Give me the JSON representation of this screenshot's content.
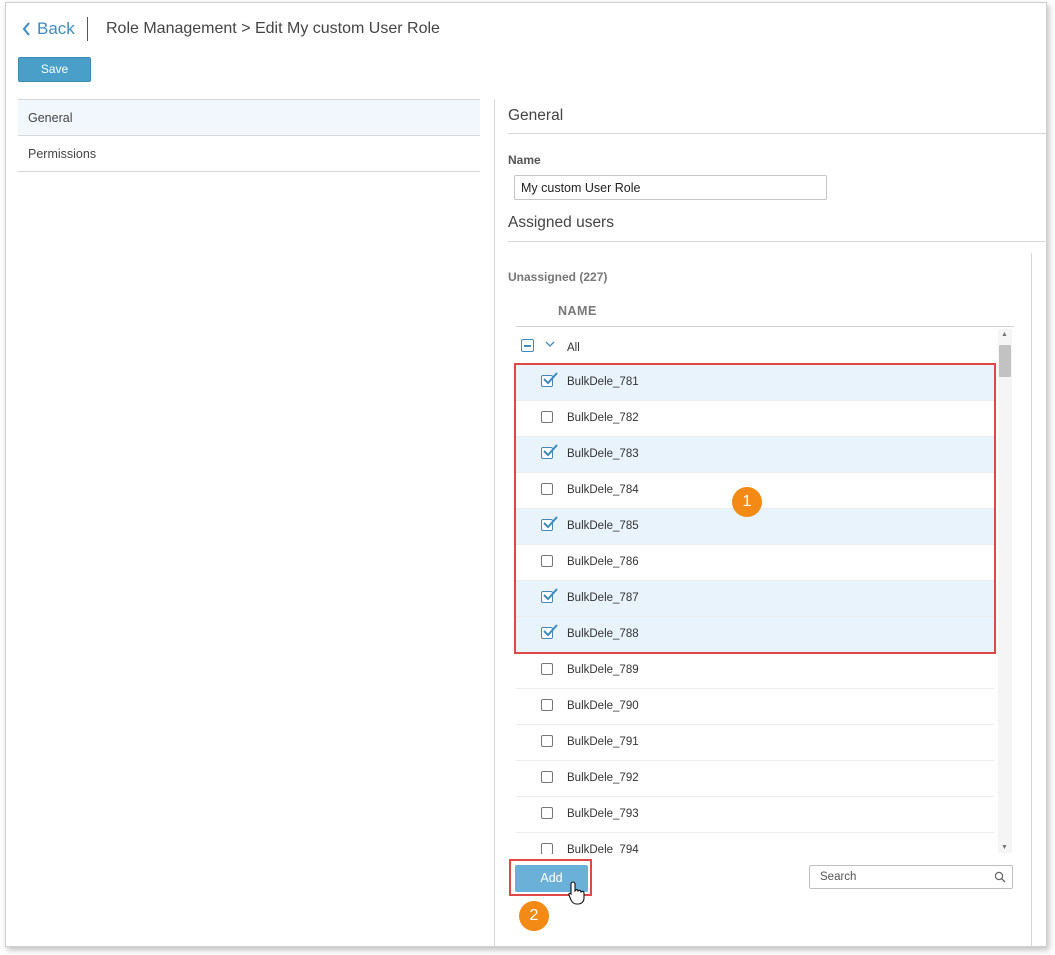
{
  "header": {
    "back_label": "Back",
    "breadcrumb": "Role Management > Edit My custom User Role",
    "save_label": "Save"
  },
  "nav": {
    "items": [
      {
        "label": "General",
        "active": true
      },
      {
        "label": "Permissions",
        "active": false
      }
    ]
  },
  "general": {
    "title": "General",
    "name_label": "Name",
    "name_value": "My custom User Role"
  },
  "assigned": {
    "title": "Assigned users",
    "unassigned_label": "Unassigned (227)",
    "column_header": "NAME",
    "all_label": "All",
    "rows": [
      {
        "name": "BulkDele_781",
        "checked": true
      },
      {
        "name": "BulkDele_782",
        "checked": false
      },
      {
        "name": "BulkDele_783",
        "checked": true
      },
      {
        "name": "BulkDele_784",
        "checked": false
      },
      {
        "name": "BulkDele_785",
        "checked": true
      },
      {
        "name": "BulkDele_786",
        "checked": false
      },
      {
        "name": "BulkDele_787",
        "checked": true
      },
      {
        "name": "BulkDele_788",
        "checked": true
      },
      {
        "name": "BulkDele_789",
        "checked": false
      },
      {
        "name": "BulkDele_790",
        "checked": false
      },
      {
        "name": "BulkDele_791",
        "checked": false
      },
      {
        "name": "BulkDele_792",
        "checked": false
      },
      {
        "name": "BulkDele_793",
        "checked": false
      },
      {
        "name": "BulkDele_794",
        "checked": false
      }
    ],
    "add_label": "Add",
    "search_placeholder": "Search"
  },
  "annotations": {
    "badge_1": "1",
    "badge_2": "2"
  },
  "colors": {
    "accent": "#4a9fc8",
    "highlight": "#e04848",
    "badge": "#f28a15",
    "row_checked": "#e8f3fb"
  }
}
